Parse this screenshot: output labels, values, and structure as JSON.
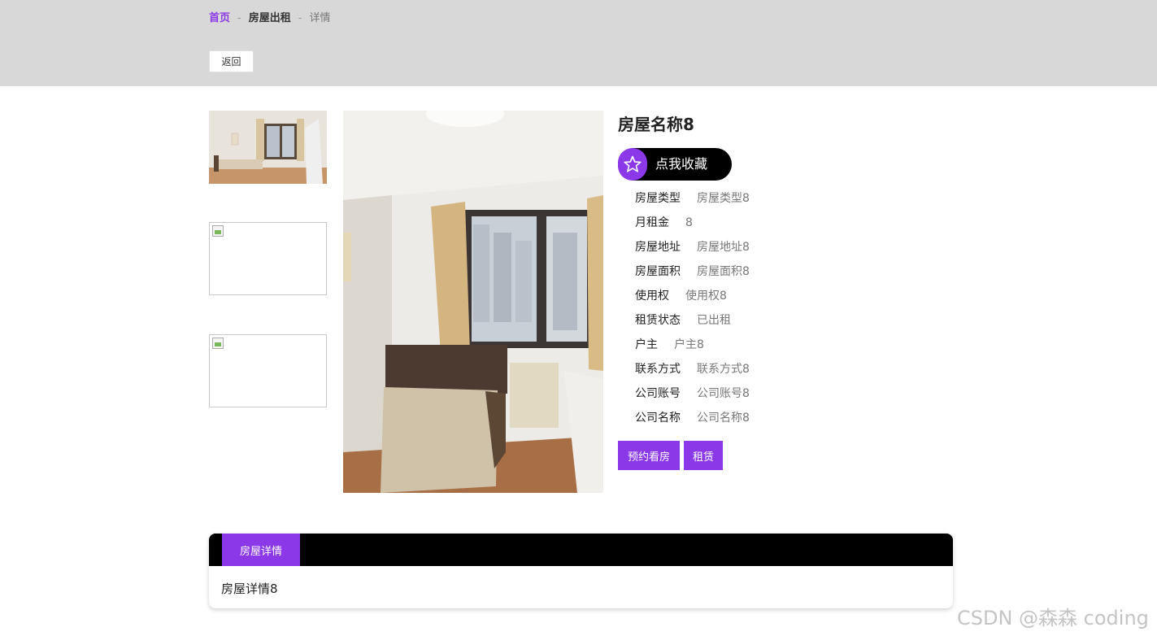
{
  "breadcrumb": {
    "home": "首页",
    "separator": "-",
    "section": "房屋出租",
    "current": "详情"
  },
  "back_label": "返回",
  "house": {
    "name": "房屋名称8",
    "favorite_label": "点我收藏",
    "details": [
      {
        "key": "房屋类型",
        "value": "房屋类型8"
      },
      {
        "key": "月租金",
        "value": "8"
      },
      {
        "key": "房屋地址",
        "value": "房屋地址8"
      },
      {
        "key": "房屋面积",
        "value": "房屋面积8"
      },
      {
        "key": "使用权",
        "value": "使用权8"
      },
      {
        "key": "租赁状态",
        "value": "已出租"
      },
      {
        "key": "户主",
        "value": "户主8"
      },
      {
        "key": "联系方式",
        "value": "联系方式8"
      },
      {
        "key": "公司账号",
        "value": "公司账号8"
      },
      {
        "key": "公司名称",
        "value": "公司名称8"
      }
    ],
    "actions": {
      "book_viewing": "预约看房",
      "rent": "租赁"
    }
  },
  "detail_section": {
    "tab_label": "房屋详情",
    "content": "房屋详情8"
  },
  "watermark": "CSDN @森森 coding",
  "colors": {
    "accent": "#8b38e8",
    "header_bg": "#d8d8d8",
    "black": "#000000"
  },
  "icons": {
    "favorite": "star-icon",
    "broken_image": "broken-image-icon"
  }
}
